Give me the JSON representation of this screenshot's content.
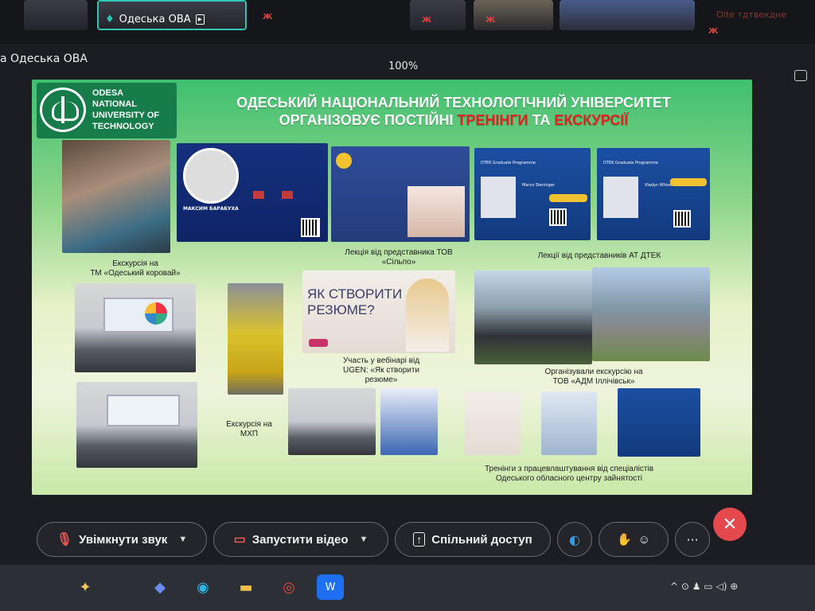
{
  "participants": {
    "tile_name": "Одеська ОВА",
    "red_marks": [
      "Ж",
      "Ж",
      "Ж",
      "Ж"
    ],
    "faint_right": "Olte тдтвекдне"
  },
  "presenter_label": "а Одеська ОВА",
  "zoom": "100%",
  "slide": {
    "logo": {
      "line1": "ODESA",
      "line2": "NATIONAL",
      "line3": "UNIVERSITY OF",
      "line4": "TECHNOLOGY"
    },
    "title_line1": "ОДЕСЬКИЙ НАЦІОНАЛЬНИЙ ТЕХНОЛОГІЧНИЙ УНІВЕРСИТЕТ",
    "title_line2_prefix": "ОРГАНІЗОВУЄ ПОСТІЙНІ ",
    "title_hl1": "ТРЕНІНГИ",
    "title_mid": " ТА ",
    "title_hl2": "ЕКСКУРСІЇ",
    "speaker_name": "МАКСИМ БАРАБУХА",
    "dtek_label": "DTEK Graduate Programme",
    "dtek_person1": "Marco Steninger",
    "dtek_person2": "Vladyn Whiss",
    "resume_title_line1": "ЯК СТВОРИТИ",
    "resume_title_line2": "РЕЗЮМЕ?",
    "captions": {
      "excursion_korovai_1": "Екскурсія на",
      "excursion_korovai_2": "ТМ «Одеський коровай»",
      "lecture_silpo_1": "Лекція від представника ТОВ",
      "lecture_silpo_2": "«Сільпо»",
      "lecture_dtek": "Лекції від представників АТ ДТЕК",
      "excursion_mhp_1": "Екскурсія на",
      "excursion_mhp_2": "МХП",
      "webinar_1": "Участь у вебінарі від",
      "webinar_2": "UGEN: «Як створити",
      "webinar_3": "резюме»",
      "adm_1": "Організували екскурсію на",
      "adm_2": "ТОВ «АДМ Іллічівськ»",
      "trainings_1": "Тренінги з працевлаштування від  спеціалістів",
      "trainings_2": "Одеського обласного центру зайнятості"
    }
  },
  "controls": {
    "unmute": "Увімкнути звук",
    "start_video": "Запустити відео",
    "share": "Спільний доступ",
    "more": "···",
    "leave": "✕"
  },
  "taskbar": {
    "tray_text": "^ ⊙ ♟ ▭ ◁) ⊕"
  },
  "colors": {
    "accent_teal": "#2ec4b6",
    "leave_red": "#e5484d",
    "title_highlight": "#e32222"
  }
}
